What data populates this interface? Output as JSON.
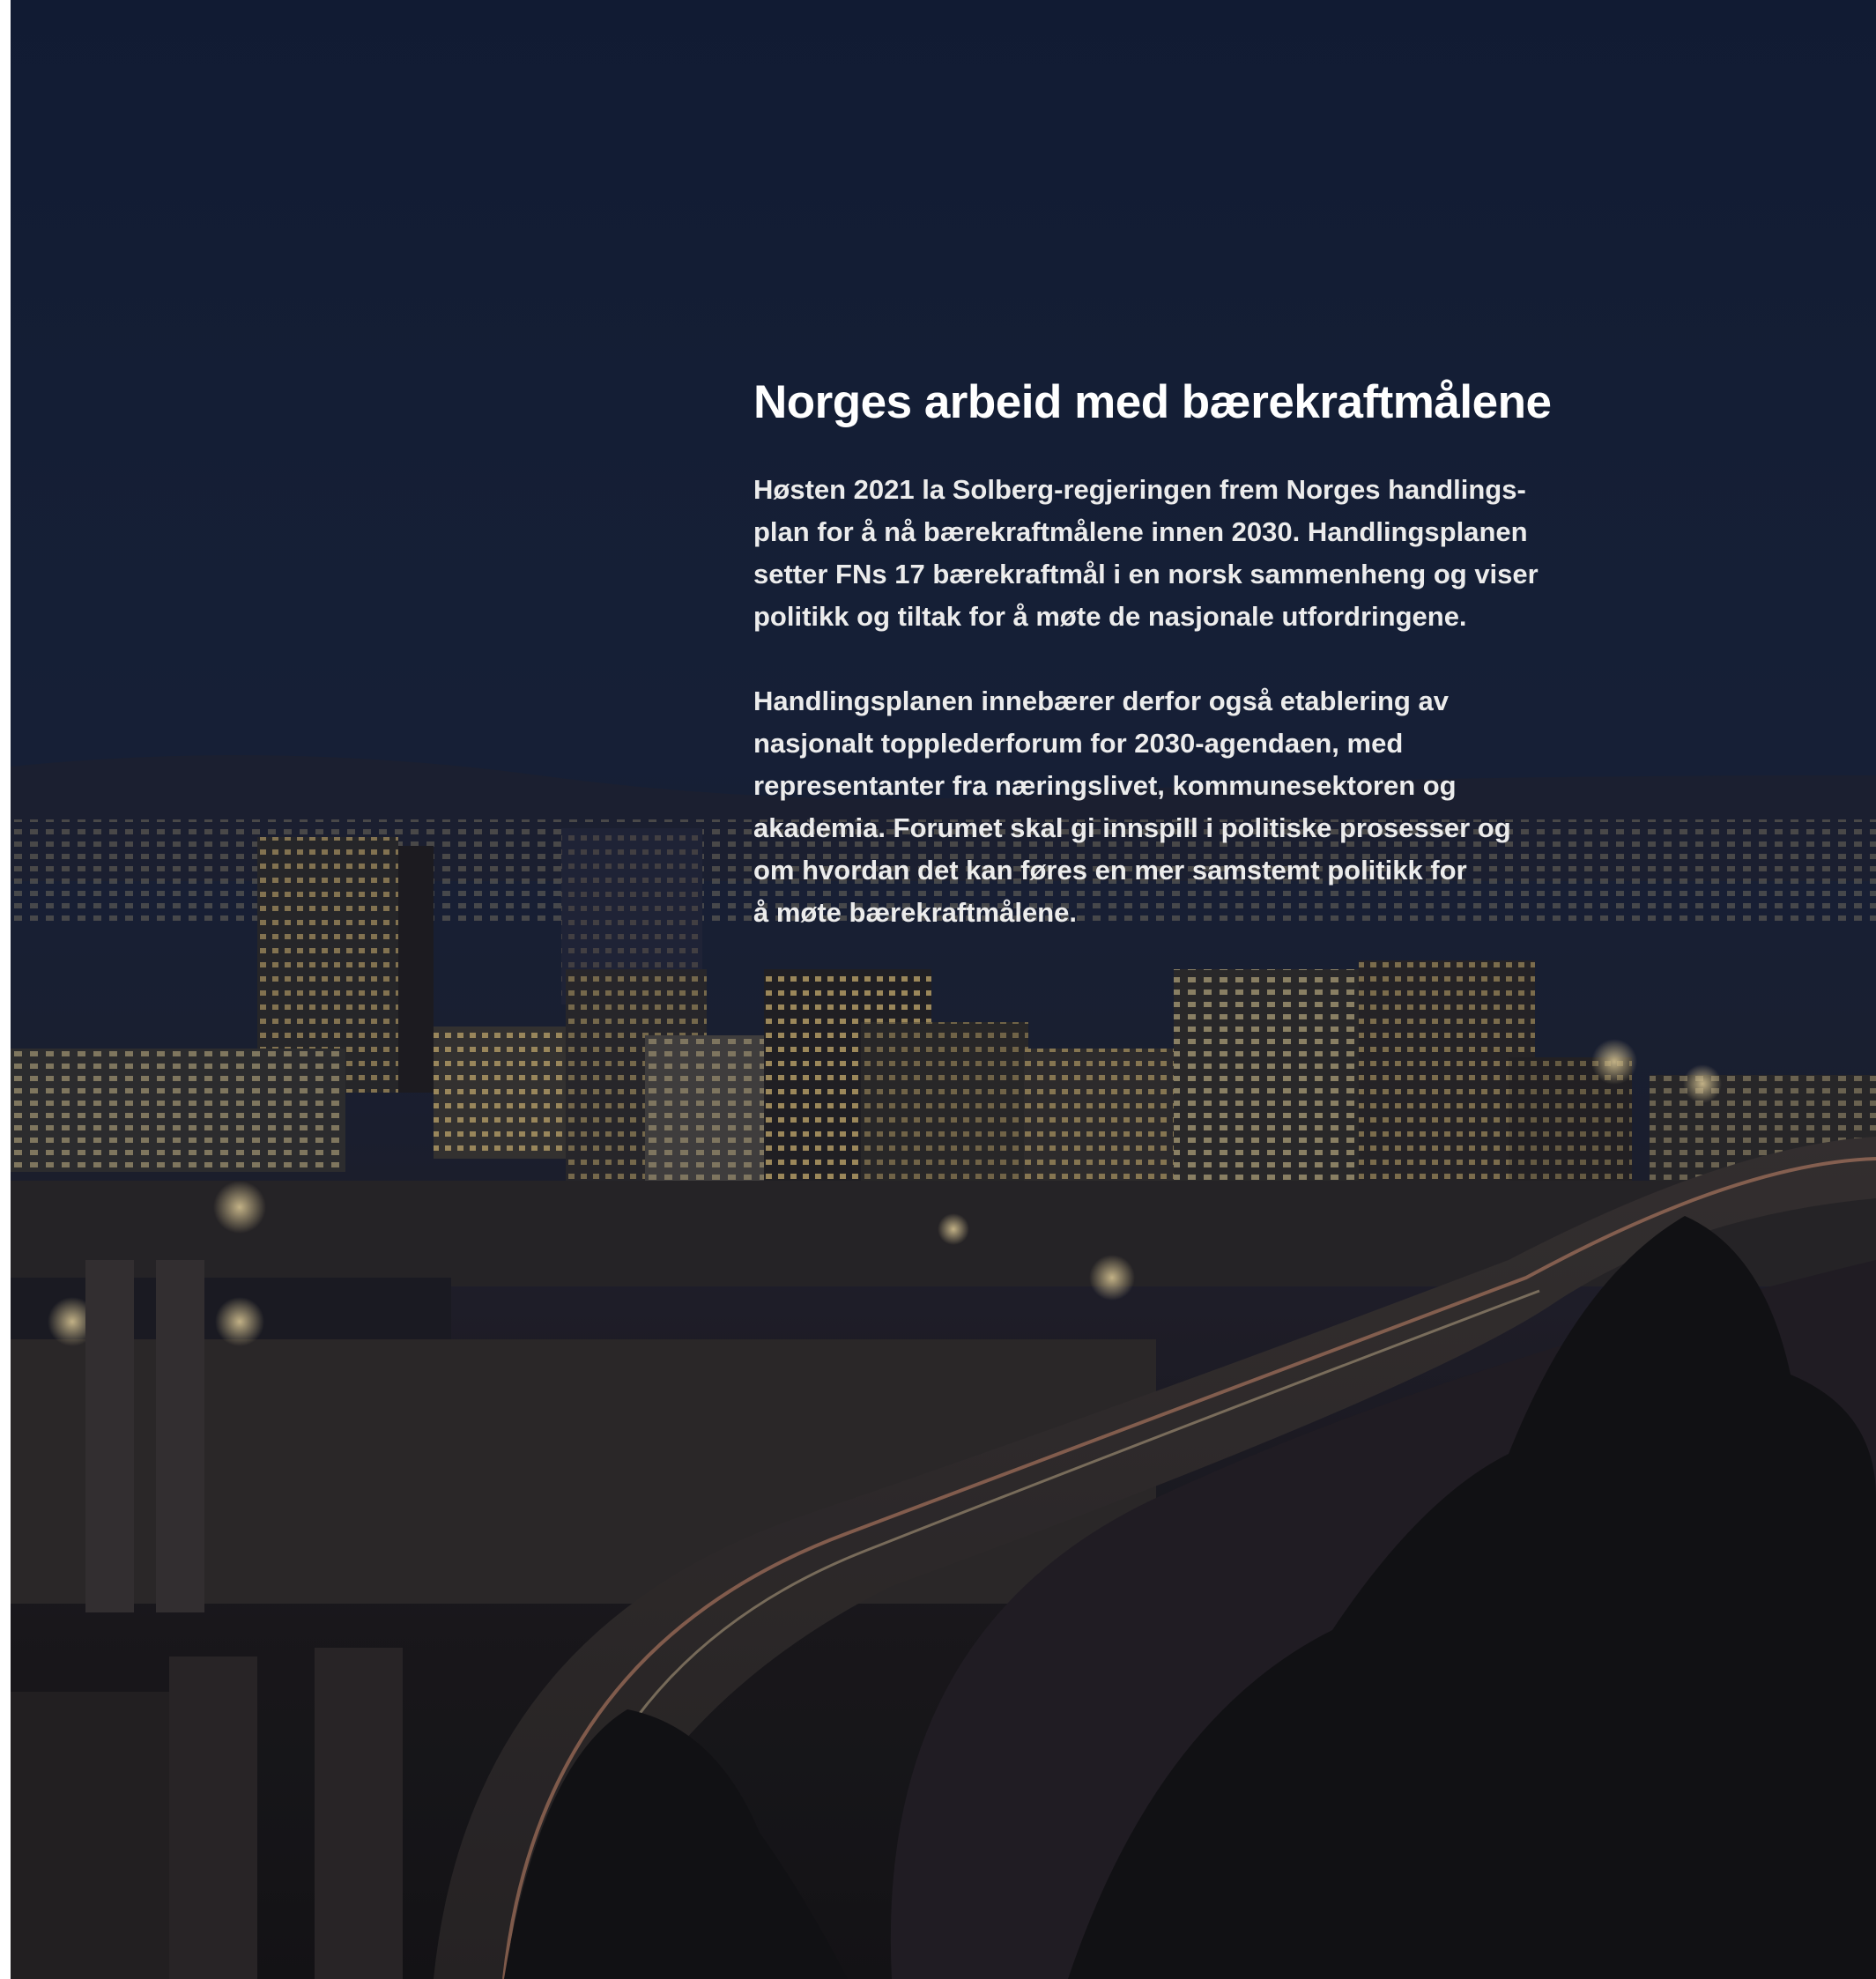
{
  "section": {
    "title": "Norges arbeid med bærekraftmålene",
    "paragraphs": [
      {
        "lines": [
          "Høsten 2021 la Solberg-regjeringen frem Norges handlings-",
          "plan for å nå bærekraftmålene innen 2030. Handlingsplanen",
          "setter FNs 17 bærekraftmål i en norsk sammenheng og viser",
          "politikk og tiltak for å møte de nasjonale utfordringene."
        ]
      },
      {
        "lines": [
          "Handlingsplanen innebærer derfor også etablering av",
          "nasjonalt topplederforum for 2030-agendaen, med",
          "representanter fra næringslivet, kommunesektoren og",
          "akademia. Forumet skal gi innspill i politiske prosesser og",
          "om hvordan det kan føres en mer samstemt politikk for",
          "å møte bærekraftmålene."
        ]
      }
    ]
  },
  "background": {
    "photo": "night-city-skyline-photo",
    "colors": {
      "sky": "#121d36",
      "ground": "#141212",
      "lights": "#ffd98a"
    }
  }
}
